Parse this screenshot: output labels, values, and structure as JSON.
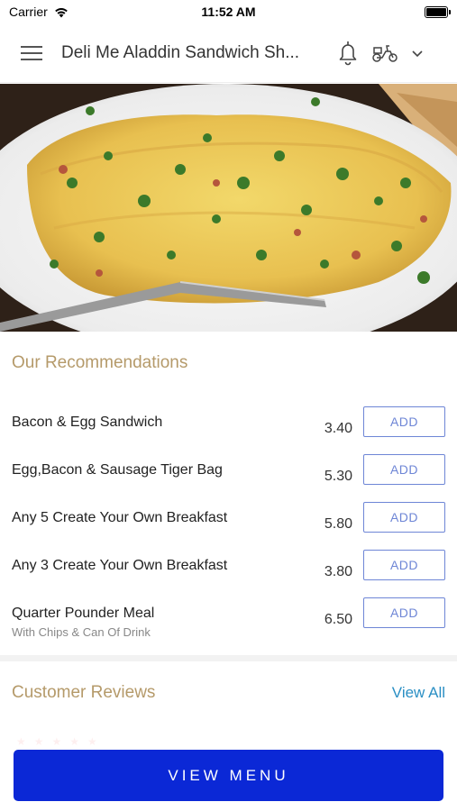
{
  "status_bar": {
    "carrier": "Carrier",
    "time": "11:52 AM"
  },
  "header": {
    "title": "Deli Me Aladdin Sandwich Sh...",
    "icons": [
      "hamburger-menu-icon",
      "bell-icon",
      "scooter-icon",
      "chevron-down-icon"
    ]
  },
  "recommendations": {
    "title": "Our Recommendations",
    "add_label": "ADD",
    "items": [
      {
        "name": "Bacon & Egg Sandwich",
        "subtitle": "",
        "price": "3.40"
      },
      {
        "name": "Egg,Bacon & Sausage Tiger Bag",
        "subtitle": "",
        "price": "5.30"
      },
      {
        "name": "Any 5 Create Your Own Breakfast",
        "subtitle": "",
        "price": "5.80"
      },
      {
        "name": "Any 3 Create Your Own Breakfast",
        "subtitle": "",
        "price": "3.80"
      },
      {
        "name": "Quarter Pounder Meal",
        "subtitle": "With Chips & Can Of Drink",
        "price": "6.50"
      }
    ]
  },
  "reviews": {
    "title": "Customer Reviews",
    "view_all": "View All"
  },
  "footer": {
    "view_menu": "VIEW MENU"
  },
  "colors": {
    "accent_gold": "#b59a6a",
    "add_button_blue": "#6e86d6",
    "link_blue": "#2a8fc4",
    "primary_button": "#0b28d6"
  }
}
